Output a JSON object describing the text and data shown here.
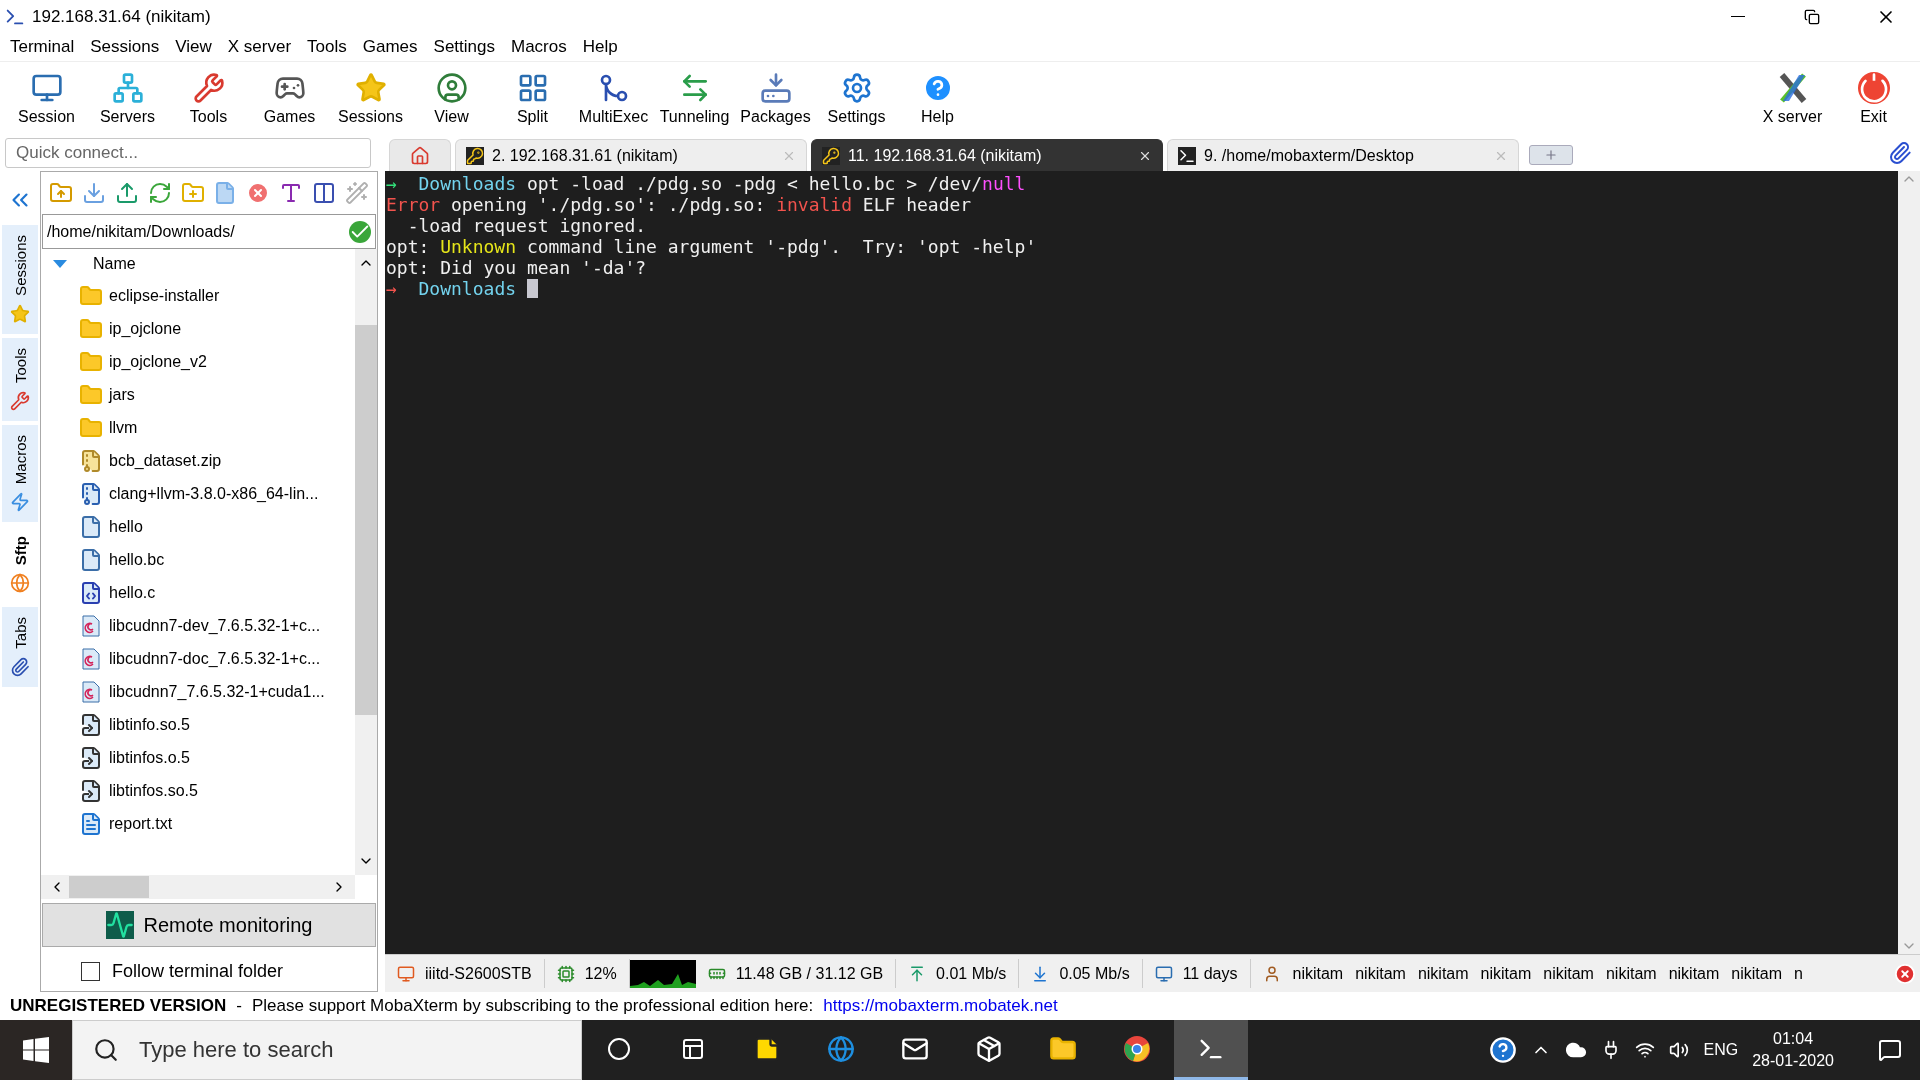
{
  "window": {
    "title": "192.168.31.64 (nikitam)"
  },
  "menu": [
    "Terminal",
    "Sessions",
    "View",
    "X server",
    "Tools",
    "Games",
    "Settings",
    "Macros",
    "Help"
  ],
  "toolbar": [
    "Session",
    "Servers",
    "Tools",
    "Games",
    "Sessions",
    "View",
    "Split",
    "MultiExec",
    "Tunneling",
    "Packages",
    "Settings",
    "Help"
  ],
  "toolbar_right": [
    "X server",
    "Exit"
  ],
  "quick_connect": {
    "placeholder": "Quick connect..."
  },
  "tabs": [
    {
      "label": "2. 192.168.31.61 (nikitam)",
      "selected": false,
      "kind": "ssh"
    },
    {
      "label": "11. 192.168.31.64 (nikitam)",
      "selected": true,
      "kind": "ssh"
    },
    {
      "label": "9. /home/mobaxterm/Desktop",
      "selected": false,
      "kind": "local"
    }
  ],
  "side_tabs": [
    {
      "label": "Sessions",
      "selected": false
    },
    {
      "label": "Tools",
      "selected": false
    },
    {
      "label": "Macros",
      "selected": false
    },
    {
      "label": "Sftp",
      "selected": true
    },
    {
      "label": "Tabs",
      "selected": false
    }
  ],
  "sftp": {
    "path": "/home/nikitam/Downloads/",
    "column": "Name",
    "files": [
      {
        "name": "eclipse-installer",
        "kind": "folder"
      },
      {
        "name": "ip_ojclone",
        "kind": "folder"
      },
      {
        "name": "ip_ojclone_v2",
        "kind": "folder"
      },
      {
        "name": "jars",
        "kind": "folder"
      },
      {
        "name": "llvm",
        "kind": "folder"
      },
      {
        "name": "bcb_dataset.zip",
        "kind": "zip"
      },
      {
        "name": "clang+llvm-3.8.0-x86_64-lin...",
        "kind": "archive"
      },
      {
        "name": "hello",
        "kind": "file"
      },
      {
        "name": "hello.bc",
        "kind": "file"
      },
      {
        "name": "hello.c",
        "kind": "csource"
      },
      {
        "name": "libcudnn7-dev_7.6.5.32-1+c...",
        "kind": "deb"
      },
      {
        "name": "libcudnn7-doc_7.6.5.32-1+c...",
        "kind": "deb"
      },
      {
        "name": "libcudnn7_7.6.5.32-1+cuda1...",
        "kind": "deb"
      },
      {
        "name": "libtinfo.so.5",
        "kind": "link"
      },
      {
        "name": "libtinfos.o.5",
        "kind": "link"
      },
      {
        "name": "libtinfos.so.5",
        "kind": "link"
      },
      {
        "name": "report.txt",
        "kind": "text"
      }
    ],
    "monitor_button": "Remote monitoring",
    "follow": {
      "label": "Follow terminal folder",
      "checked": false
    }
  },
  "terminal": {
    "lines": [
      {
        "segments": [
          {
            "text": "→",
            "color": "#33e07a"
          },
          {
            "text": "  Downloads",
            "color": "#73d3ee"
          },
          {
            "text": " opt -load ./pdg.so -pdg < hello.bc > /dev/",
            "color": "#f0f0f0"
          },
          {
            "text": "null",
            "color": "#ff4fff"
          }
        ]
      },
      {
        "segments": [
          {
            "text": "Error",
            "color": "#f2534d"
          },
          {
            "text": " opening './pdg.so': ./pdg.so: ",
            "color": "#f0f0f0"
          },
          {
            "text": "invalid",
            "color": "#f2534d"
          },
          {
            "text": " ELF header",
            "color": "#f0f0f0"
          }
        ]
      },
      {
        "segments": [
          {
            "text": "  -load request ignored.",
            "color": "#f0f0f0"
          }
        ]
      },
      {
        "segments": [
          {
            "text": "opt: ",
            "color": "#f0f0f0"
          },
          {
            "text": "Unknown",
            "color": "#e5e51a"
          },
          {
            "text": " command line argument '-pdg'.  Try: 'opt -help'",
            "color": "#f0f0f0"
          }
        ]
      },
      {
        "segments": [
          {
            "text": "opt: Did you mean '-da'?",
            "color": "#f0f0f0"
          }
        ]
      },
      {
        "segments": [
          {
            "text": "→",
            "color": "#f2534d"
          },
          {
            "text": "  Downloads",
            "color": "#73d3ee"
          }
        ],
        "cursor": true
      }
    ]
  },
  "status_bar": {
    "host": "iiitd-S2600STB",
    "cpu": "12%",
    "memory": "11.48 GB / 31.12 GB",
    "upload": "0.01 Mb/s",
    "download": "0.05 Mb/s",
    "uptime": "11 days",
    "users": [
      "nikitam",
      "nikitam",
      "nikitam",
      "nikitam",
      "nikitam",
      "nikitam",
      "nikitam",
      "nikitam",
      "n"
    ]
  },
  "notice": {
    "label": "UNREGISTERED VERSION",
    "separator": "-",
    "message": "Please support MobaXterm by subscribing to the professional edition here:",
    "link": "https://mobaxterm.mobatek.net"
  },
  "taskbar": {
    "search": {
      "placeholder": "Type here to search"
    },
    "apps": [
      {
        "selected": false
      },
      {
        "selected": false
      },
      {
        "selected": false
      },
      {
        "selected": false
      },
      {
        "selected": false
      },
      {
        "selected": false
      },
      {
        "selected": true
      }
    ],
    "language": "ENG",
    "time": "01:04",
    "date": "28-01-2020"
  }
}
